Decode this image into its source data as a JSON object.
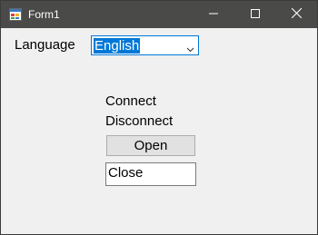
{
  "window": {
    "title": "Form1"
  },
  "language": {
    "label": "Language",
    "selected": "English"
  },
  "labels": {
    "connect": "Connect",
    "disconnect": "Disconnect"
  },
  "buttons": {
    "open": "Open"
  },
  "textbox": {
    "value": "Close"
  },
  "icons": {
    "app": "form-app-icon",
    "minimize": "minimize-icon",
    "maximize": "maximize-icon",
    "close": "close-icon",
    "dropdown": "chevron-down-icon"
  },
  "colors": {
    "titlebar": "#4a4a48",
    "accent": "#0078d7",
    "background": "#f0f0f0"
  }
}
